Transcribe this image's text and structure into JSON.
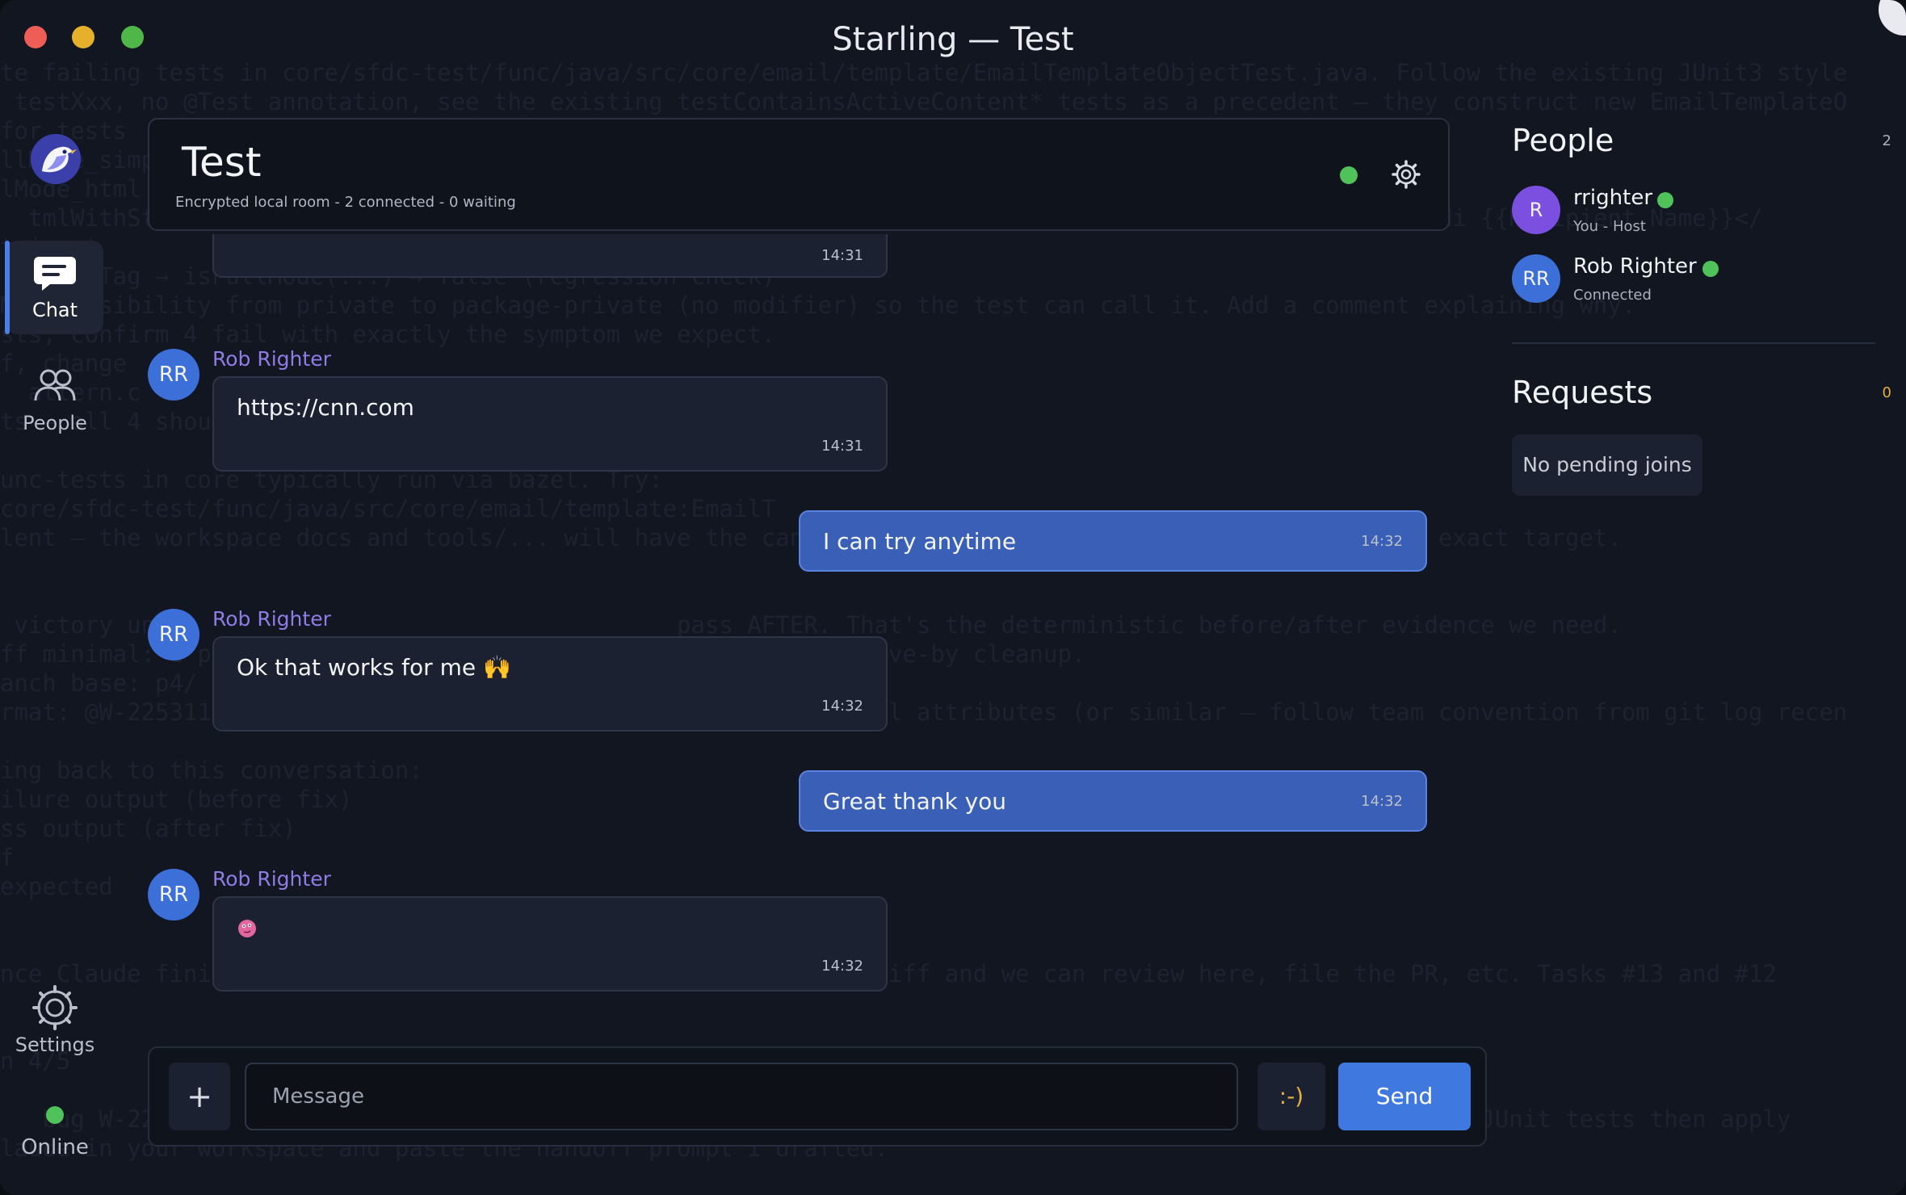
{
  "window": {
    "title": "Starling — Test"
  },
  "background_code": [
    "te failing tests in core/sfdc-test/func/java/src/core/email/template/EmailTemplateObjectTest.java. Follow the existing JUnit3 style",
    " testXxx, no @Test annotation, see the existing testContainsActiveContent* tests as a precedent — they construct new EmailTemplateO",
    "for tests",
    "llMode_simp",
    "lMode_html",
    "  tmlWithStyleAndLang → <html lang=\"en\" style=\"overflow-y: hidden;\"><head><title></title></head><body>Hi {{Recipient.Name}}</",
    "t input",
    "  oHtmlTag → isFullMode(...) → false (regression check)",
    "Mode visibility from private to package-private (no modifier) so the test can call it. Add a comment explaining why.",
    "sts, confirm 4 fail with exactly the symptom we expect.",
    "f, change",
    "  attern.c                                   SENSITIVE);",
    "ts — all 4 should                              all pass.",
    "",
    "unc-tests in core typically run via bazel. Try:",
    "core/sfdc-test/func/java/src/core/email/template:EmailT",
    "lent — the workspace docs and tools/... will have the canonical invocation. Check BUILD files for the exact target.",
    "",
    "",
    " victory until                                  pass AFTER. That's the deterministic before/after evidence we need.",
    "ff minimal: 1 p                                 methods. No drive-by cleanup.",
    "anch base: p4/",
    "rmat: @W-22531186 fix isFullMode regex to match <html> with real attributes (or similar — follow team convention from git log recen",
    "",
    "ing back to this conversation:",
    "ilure output (before fix)",
    "ss output (after fix)",
    "f",
    "expected",
    "",
    "",
    "nce Claude finishes, paste back the build/test output and the diff and we can review here, file the PR, etc. Tasks #13 and #12",
    "",
    "",
    "n 4/5",
    "",
    "   bug W-22531186 (isFullMode regex rejecting real html attributes) in core. Current task: write failing JUnit tests then apply",
    "laude in your workspace and paste the handoff prompt I drafted."
  ],
  "rail": {
    "items": [
      {
        "label": "Chat",
        "icon": "chat-icon"
      },
      {
        "label": "People",
        "icon": "people-icon"
      },
      {
        "label": "Settings",
        "icon": "gear-icon"
      }
    ],
    "status": "Online"
  },
  "room": {
    "title": "Test",
    "subtitle": "Encrypted local room - 2 connected - 0 waiting"
  },
  "messages": [
    {
      "sender": "",
      "initials": "",
      "text": "",
      "time": "14:31",
      "outgoing": false
    },
    {
      "sender": "Rob Righter",
      "initials": "RR",
      "text": "https://cnn.com",
      "time": "14:31",
      "outgoing": false
    },
    {
      "sender": "",
      "initials": "",
      "text": "I can try anytime",
      "time": "14:32",
      "outgoing": true
    },
    {
      "sender": "Rob Righter",
      "initials": "RR",
      "text": "Ok that works for me 🙌",
      "time": "14:32",
      "outgoing": false
    },
    {
      "sender": "",
      "initials": "",
      "text": "Great thank you",
      "time": "14:32",
      "outgoing": true
    },
    {
      "sender": "Rob Righter",
      "initials": "RR",
      "text": "",
      "time": "14:32",
      "outgoing": false
    }
  ],
  "composer": {
    "add_label": "+",
    "placeholder": "Message",
    "emoji_label": ":-)",
    "send_label": "Send"
  },
  "people": {
    "title": "People",
    "count": "2",
    "members": [
      {
        "initials": "R",
        "name": "rrighter",
        "status": "You - Host",
        "color": "#7b4fe0"
      },
      {
        "initials": "RR",
        "name": "Rob Righter",
        "status": "Connected",
        "color": "#3d6fd8"
      }
    ]
  },
  "requests": {
    "title": "Requests",
    "count": "0",
    "empty": "No pending joins"
  },
  "colors": {
    "accent": "#3f78de",
    "online": "#4fc25a",
    "sender_name": "#8f7ce6",
    "requests_count": "#e3b03b"
  }
}
